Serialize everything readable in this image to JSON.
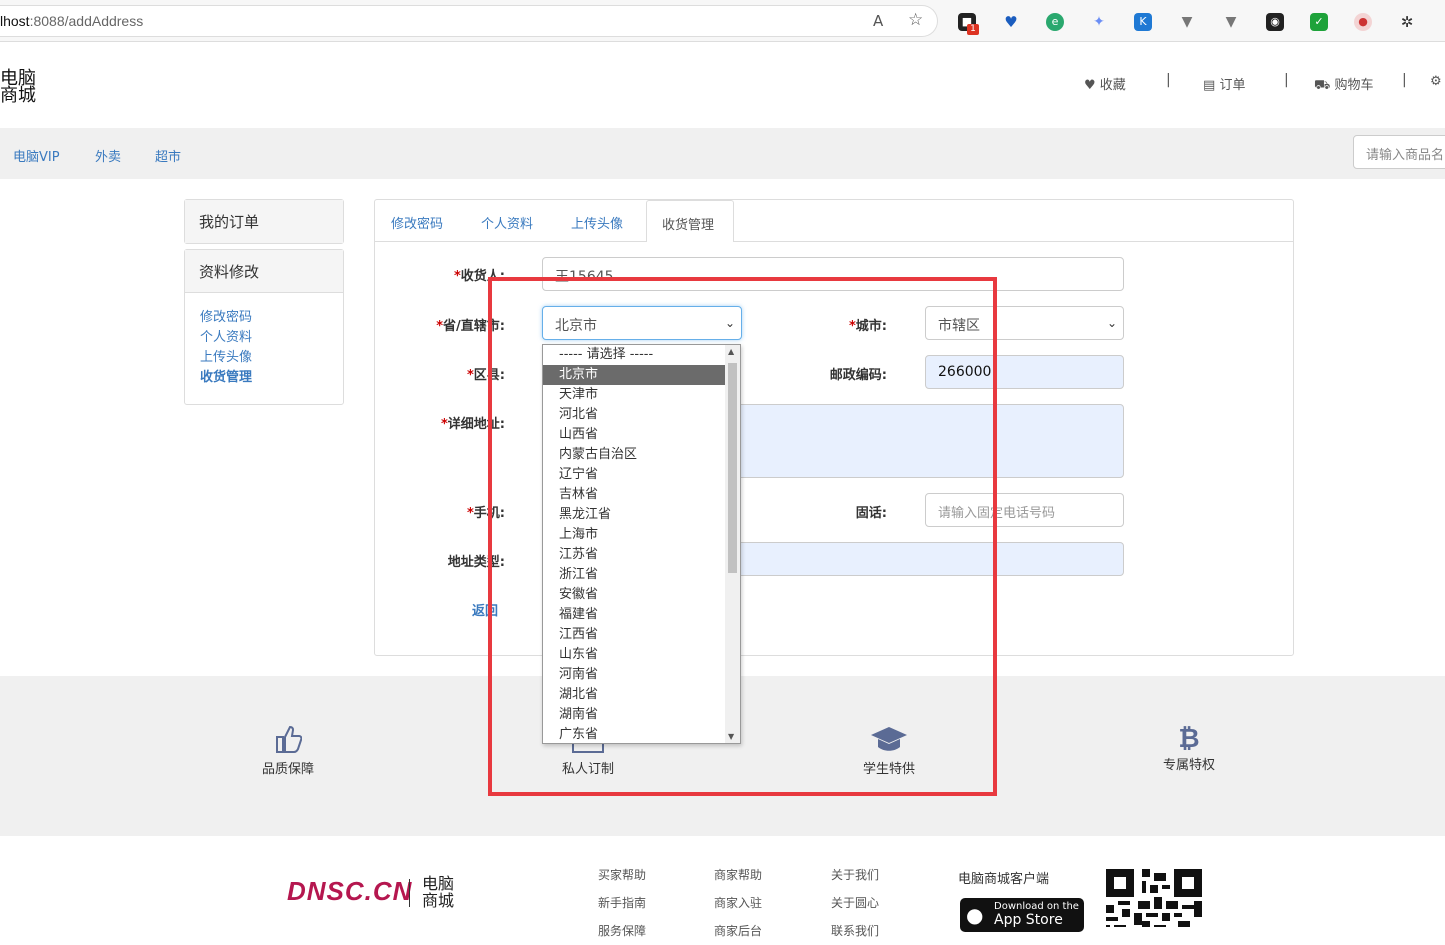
{
  "browser": {
    "url_host": "lhost",
    "url_rest": ":8088/addAddress",
    "icons": [
      "read-aloud-icon",
      "favorite-star-icon",
      "extension-1-icon",
      "extension-2-icon",
      "edge-icon",
      "extension-3-icon",
      "extension-4-icon",
      "extension-5-icon",
      "extension-6-icon",
      "extension-7-icon",
      "extension-8-icon",
      "extension-9-icon",
      "extensions-puzzle-icon"
    ],
    "badge": "1"
  },
  "header": {
    "logo_line1": "电脑",
    "logo_line2": "商城",
    "links": [
      {
        "label": "收藏",
        "icon": "heart-icon"
      },
      {
        "label": "订单",
        "icon": "document-icon"
      },
      {
        "label": "购物车",
        "icon": "cart-icon"
      }
    ],
    "separator": "|"
  },
  "nav": {
    "items": [
      "电脑VIP",
      "外卖",
      "超市"
    ],
    "search_placeholder": "请输入商品名"
  },
  "sidebar": {
    "box1_title": "我的订单",
    "box2_title": "资料修改",
    "links": [
      "修改密码",
      "个人资料",
      "上传头像",
      "收货管理"
    ]
  },
  "tabs": [
    "修改密码",
    "个人资料",
    "上传头像",
    "收货管理"
  ],
  "form": {
    "receiver_label": "收货人:",
    "receiver_value": "王15645",
    "province_label": "省/直辖市:",
    "province_value": "北京市",
    "city_label": "城市:",
    "city_value": "市辖区",
    "district_label": "区县:",
    "postcode_label": "邮政编码:",
    "postcode_value": "266000",
    "address_label": "详细地址:",
    "mobile_label": "手机:",
    "phone_label": "固话:",
    "phone_placeholder": "请输入固定电话号码",
    "addrtype_label": "地址类型:",
    "back_link": "返回",
    "required_mark": "*"
  },
  "dropdown": {
    "options": [
      "----- 请选择 -----",
      "北京市",
      "天津市",
      "河北省",
      "山西省",
      "内蒙古自治区",
      "辽宁省",
      "吉林省",
      "黑龙江省",
      "上海市",
      "江苏省",
      "浙江省",
      "安徽省",
      "福建省",
      "江西省",
      "山东省",
      "河南省",
      "湖北省",
      "湖南省",
      "广东省"
    ],
    "selected_index": 1
  },
  "features": [
    {
      "label": "品质保障",
      "icon": "thumbs-up-icon"
    },
    {
      "label": "私人订制",
      "icon": "custom-icon"
    },
    {
      "label": "学生特供",
      "icon": "graduation-cap-icon"
    },
    {
      "label": "专属特权",
      "icon": "bitcoin-icon"
    }
  ],
  "footer": {
    "brand": "DNSC.CN",
    "brand_cn1": "电脑",
    "brand_cn2": "商城",
    "col1": [
      "买家帮助",
      "新手指南",
      "服务保障"
    ],
    "col2": [
      "商家帮助",
      "商家入驻",
      "商家后台"
    ],
    "col3": [
      "关于我们",
      "关于圆心",
      "联系我们"
    ],
    "app_title": "电脑商城客户端",
    "appstore_small": "Download on the",
    "appstore_big": "App Store"
  },
  "colors": {
    "link": "#3a7abf",
    "required": "#cc0000",
    "highlight_box": "#e8393f",
    "brand": "#b5174f"
  }
}
